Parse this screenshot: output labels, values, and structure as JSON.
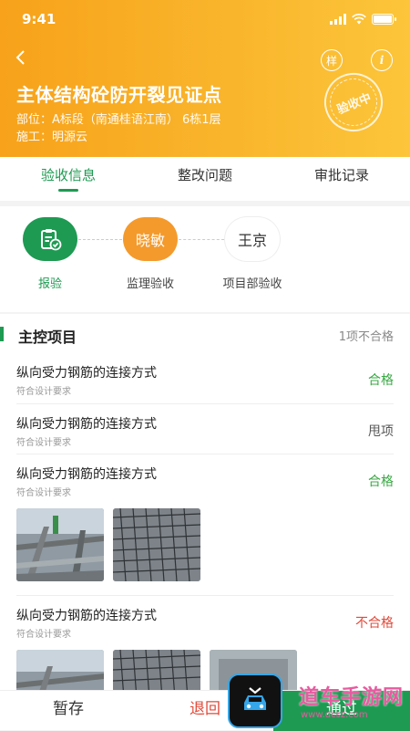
{
  "status_bar": {
    "time": "9:41"
  },
  "header": {
    "title": "主体结构砼防开裂见证点",
    "location": "部位：A标段（南通桂语江南） 6栋1层",
    "contractor": "施工：明源云",
    "sample_label": "样",
    "info_label": "i",
    "stamp_text": "验收中",
    "colors": {
      "gradient_start": "#f7a21a",
      "gradient_end": "#fcc53a"
    }
  },
  "tabs": [
    {
      "label": "验收信息",
      "active": true
    },
    {
      "label": "整改问题",
      "active": false
    },
    {
      "label": "审批记录",
      "active": false
    }
  ],
  "steps": [
    {
      "circle": "",
      "label": "报验",
      "icon": "clipboard-check-icon",
      "state": "done"
    },
    {
      "circle": "晓敏",
      "label": "监理验收",
      "state": "current"
    },
    {
      "circle": "王京",
      "label": "项目部验收",
      "state": "pending"
    }
  ],
  "section": {
    "title": "主控项目",
    "count": "1项不合格",
    "items": [
      {
        "name": "纵向受力钢筋的连接方式",
        "sub": "符合设计要求",
        "result": "合格"
      },
      {
        "name": "纵向受力钢筋的连接方式",
        "sub": "符合设计要求",
        "result": "甩项"
      },
      {
        "name": "纵向受力钢筋的连接方式",
        "sub": "符合设计要求",
        "result": "合格"
      },
      {
        "name": "纵向受力钢筋的连接方式",
        "sub": "符合设计要求",
        "result": "不合格"
      }
    ]
  },
  "bottom": {
    "save": "暂存",
    "return": "退回",
    "pass": "通过"
  },
  "watermark": {
    "text": "道车手游网",
    "url": "www.dcsz.com"
  },
  "colors": {
    "accent": "#1e9a52",
    "pass": "#3aa845",
    "fail": "#e04a3a",
    "orange": "#f49a2c"
  }
}
